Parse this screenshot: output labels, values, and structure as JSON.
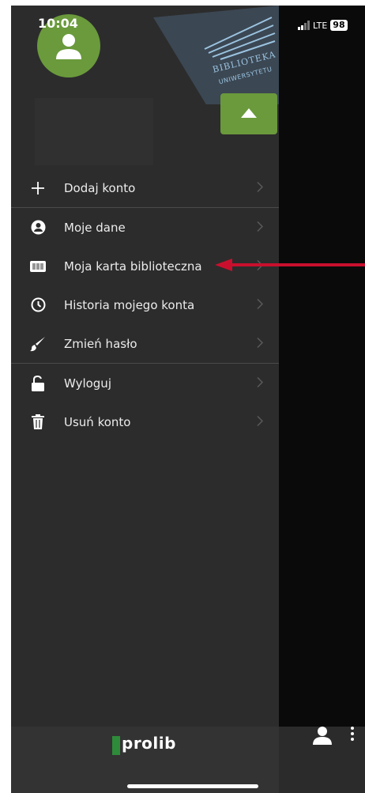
{
  "status_bar": {
    "time": "10:04",
    "network": "LTE",
    "battery": "98"
  },
  "header": {
    "logo_line1": "BIBLIOTEKA",
    "logo_line2": "UNIWERSYTETU"
  },
  "menu": {
    "items": [
      {
        "label": "Dodaj konto",
        "icon": "plus-icon"
      },
      {
        "label": "Moje dane",
        "icon": "user-circle-icon"
      },
      {
        "label": "Moja karta biblioteczna",
        "icon": "barcode-card-icon"
      },
      {
        "label": "Historia mojego konta",
        "icon": "history-icon"
      },
      {
        "label": "Zmień hasło",
        "icon": "brush-icon"
      },
      {
        "label": "Wyloguj",
        "icon": "unlock-icon"
      },
      {
        "label": "Usuń konto",
        "icon": "trash-icon"
      }
    ]
  },
  "footer": {
    "brand": "prolib"
  },
  "colors": {
    "accent_green": "#6a9a3c",
    "drawer_bg": "#2c2c2c",
    "annotation_red": "#c8102e"
  }
}
